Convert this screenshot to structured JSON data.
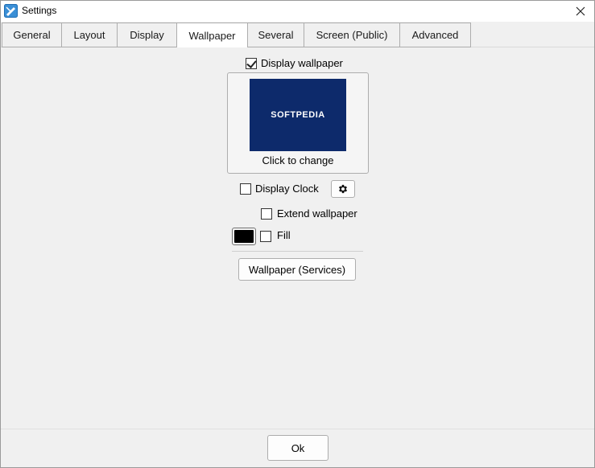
{
  "window": {
    "title": "Settings"
  },
  "tabs": [
    {
      "label": "General"
    },
    {
      "label": "Layout"
    },
    {
      "label": "Display"
    },
    {
      "label": "Wallpaper",
      "active": true
    },
    {
      "label": "Several"
    },
    {
      "label": "Screen (Public)"
    },
    {
      "label": "Advanced"
    }
  ],
  "wallpaper": {
    "display_wallpaper_label": "Display wallpaper",
    "display_wallpaper_checked": true,
    "thumbnail_text": "SOFTPEDIA",
    "thumbnail_color": "#0d2a6b",
    "change_caption": "Click to change",
    "display_clock_label": "Display Clock",
    "display_clock_checked": false,
    "extend_label": "Extend wallpaper",
    "extend_checked": false,
    "fill_color": "#000000",
    "fill_label": "Fill",
    "fill_checked": false,
    "services_button": "Wallpaper (Services)"
  },
  "footer": {
    "ok_label": "Ok"
  },
  "icons": {
    "app": "settings-app-icon",
    "close": "close-icon",
    "clock_settings": "gear-icon"
  }
}
